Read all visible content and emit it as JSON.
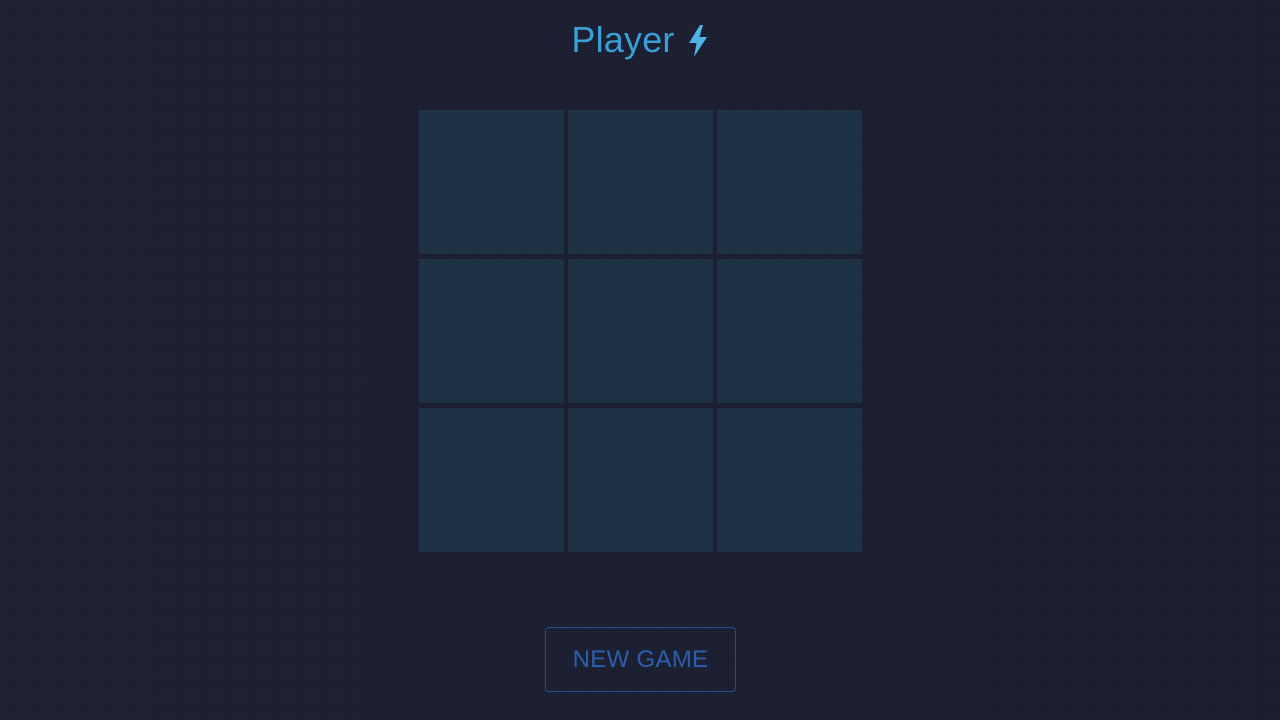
{
  "header": {
    "player_label": "Player",
    "turn_icon": "lightning-bolt-icon",
    "accent_color": "#3a9fd6"
  },
  "board": {
    "rows": 3,
    "columns": 3,
    "cells": [
      "",
      "",
      "",
      "",
      "",
      "",
      "",
      "",
      ""
    ],
    "cell_color": "#1a2f42"
  },
  "controls": {
    "new_game_label": "NEW GAME",
    "button_color": "#2a5fae"
  },
  "background_color": "#1a1c2e"
}
